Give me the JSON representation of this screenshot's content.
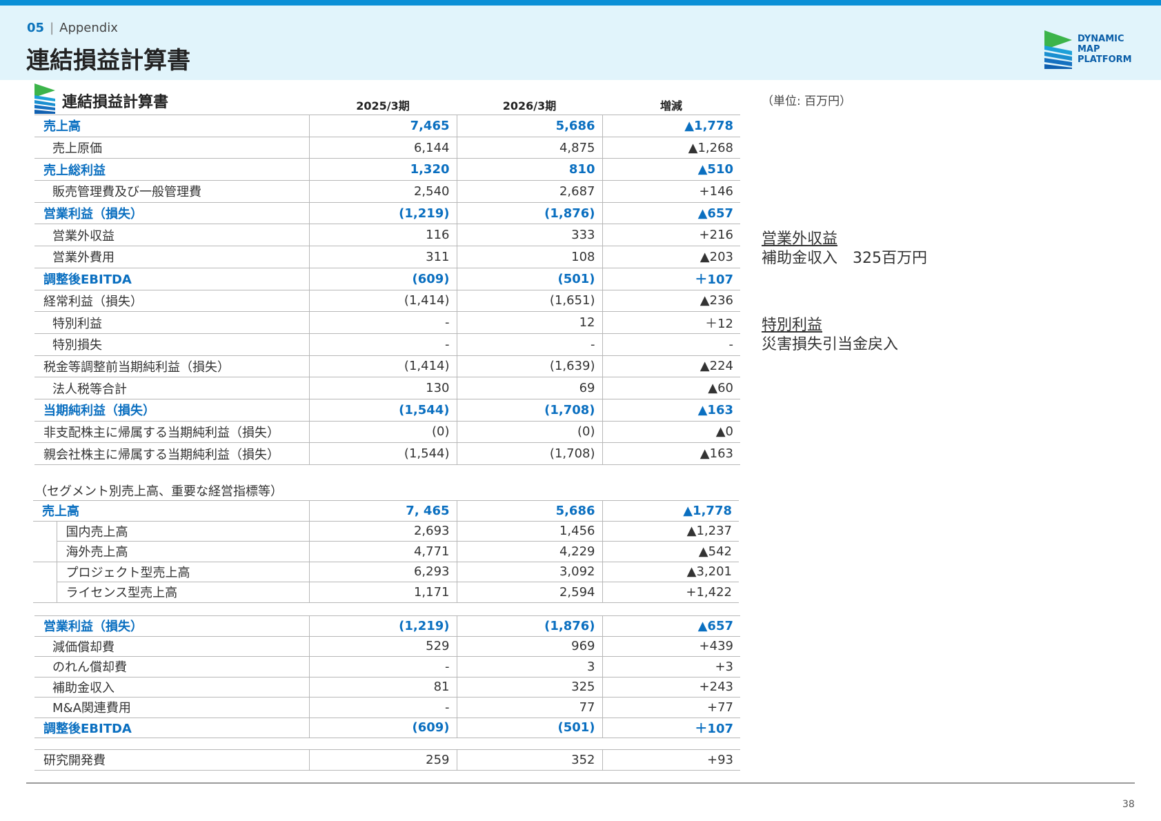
{
  "header": {
    "section_number": "05",
    "section_label": "Appendix",
    "title": "連結損益計算書",
    "logo_lines": [
      "DYNAMIC",
      "MAP",
      "PLATFORM"
    ]
  },
  "table": {
    "title": "連結損益計算書",
    "columns": [
      "2025/3期",
      "2026/3期",
      "増減"
    ],
    "unit": "（単位: 百万円）",
    "rows": [
      {
        "label": "売上高",
        "v1": "7,465",
        "v2": "5,686",
        "diff": "▲1,778"
      },
      {
        "label": "売上原価",
        "v1": "6,144",
        "v2": "4,875",
        "diff": "▲1,268"
      },
      {
        "label": "売上総利益",
        "v1": "1,320",
        "v2": "810",
        "diff": "▲510"
      },
      {
        "label": "販売管理費及び一般管理費",
        "v1": "2,540",
        "v2": "2,687",
        "diff": "+146"
      },
      {
        "label": "営業利益（損失）",
        "v1": "(1,219)",
        "v2": "(1,876)",
        "diff": "▲657"
      },
      {
        "label": "営業外収益",
        "v1": "116",
        "v2": "333",
        "diff": "+216"
      },
      {
        "label": "営業外費用",
        "v1": "311",
        "v2": "108",
        "diff": "▲203"
      },
      {
        "label": "調整後EBITDA",
        "v1": "(609)",
        "v2": "(501)",
        "diff": "＋107"
      },
      {
        "label": "経常利益（損失）",
        "v1": "(1,414)",
        "v2": "(1,651)",
        "diff": "▲236"
      },
      {
        "label": "特別利益",
        "v1": "-",
        "v2": "12",
        "diff": "＋12"
      },
      {
        "label": "特別損失",
        "v1": "-",
        "v2": "-",
        "diff": "-"
      },
      {
        "label": "税金等調整前当期純利益（損失）",
        "v1": "(1,414)",
        "v2": "(1,639)",
        "diff": "▲224"
      },
      {
        "label": "法人税等合計",
        "v1": "130",
        "v2": "69",
        "diff": "▲60"
      },
      {
        "label": "当期純利益（損失）",
        "v1": "(1,544)",
        "v2": "(1,708)",
        "diff": "▲163"
      },
      {
        "label": "非支配株主に帰属する当期純利益（損失）",
        "v1": "(0)",
        "v2": "(0)",
        "diff": "▲0"
      },
      {
        "label": "親会社株主に帰属する当期純利益（損失）",
        "v1": "(1,544)",
        "v2": "(1,708)",
        "diff": "▲163"
      }
    ]
  },
  "segment": {
    "caption": "（セグメント別売上高、重要な経営指標等）",
    "total": {
      "label": "売上高",
      "v1": "7, 465",
      "v2": "5,686",
      "diff": "▲1,778"
    },
    "rows": [
      {
        "label": "国内売上高",
        "v1": "2,693",
        "v2": "1,456",
        "diff": "▲1,237"
      },
      {
        "label": "海外売上高",
        "v1": "4,771",
        "v2": "4,229",
        "diff": "▲542"
      },
      {
        "label": "プロジェクト型売上高",
        "v1": "6,293",
        "v2": "3,092",
        "diff": "▲3,201"
      },
      {
        "label": "ライセンス型売上高",
        "v1": "1,171",
        "v2": "2,594",
        "diff": "+1,422"
      }
    ]
  },
  "ebitda": {
    "rows": [
      {
        "label": "営業利益（損失）",
        "v1": "(1,219)",
        "v2": "(1,876)",
        "diff": "▲657"
      },
      {
        "label": "減価償却費",
        "v1": "529",
        "v2": "969",
        "diff": "+439"
      },
      {
        "label": "のれん償却費",
        "v1": "-",
        "v2": "3",
        "diff": "+3"
      },
      {
        "label": "補助金収入",
        "v1": "81",
        "v2": "325",
        "diff": "+243"
      },
      {
        "label": "M&A関連費用",
        "v1": "-",
        "v2": "77",
        "diff": "+77"
      },
      {
        "label": "調整後EBITDA",
        "v1": "(609)",
        "v2": "(501)",
        "diff": "＋107"
      }
    ]
  },
  "rnd": {
    "label": "研究開発費",
    "v1": "259",
    "v2": "352",
    "diff": "+93"
  },
  "notes": {
    "non_operating_head": "営業外収益",
    "non_operating_body": "補助金収入　325百万円",
    "extraordinary_head": "特別利益",
    "extraordinary_body": "災害損失引当金戻入"
  },
  "footer": {
    "page_number": "38"
  }
}
